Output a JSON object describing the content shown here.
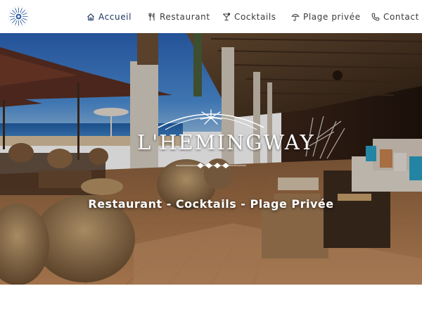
{
  "nav": {
    "logo_icon": "sun-flower-logo-icon",
    "items": [
      {
        "label": "Accueil",
        "icon": "home-icon",
        "active": true
      },
      {
        "label": "Restaurant",
        "icon": "utensils-icon",
        "active": false
      },
      {
        "label": "Cocktails",
        "icon": "cocktail-icon",
        "active": false
      },
      {
        "label": "Plage privée",
        "icon": "umbrella-icon",
        "active": false
      },
      {
        "label": "Contact",
        "icon": "phone-icon",
        "active": false
      }
    ]
  },
  "hero": {
    "brand_name": "L'HEMINGWAY",
    "tagline": "Restaurant - Cocktails - Plage Privée"
  },
  "colors": {
    "nav_text": "#3b3b3b",
    "nav_active": "#1b3560",
    "logo_blue": "#2d5aa0",
    "hero_text": "#ffffff"
  }
}
